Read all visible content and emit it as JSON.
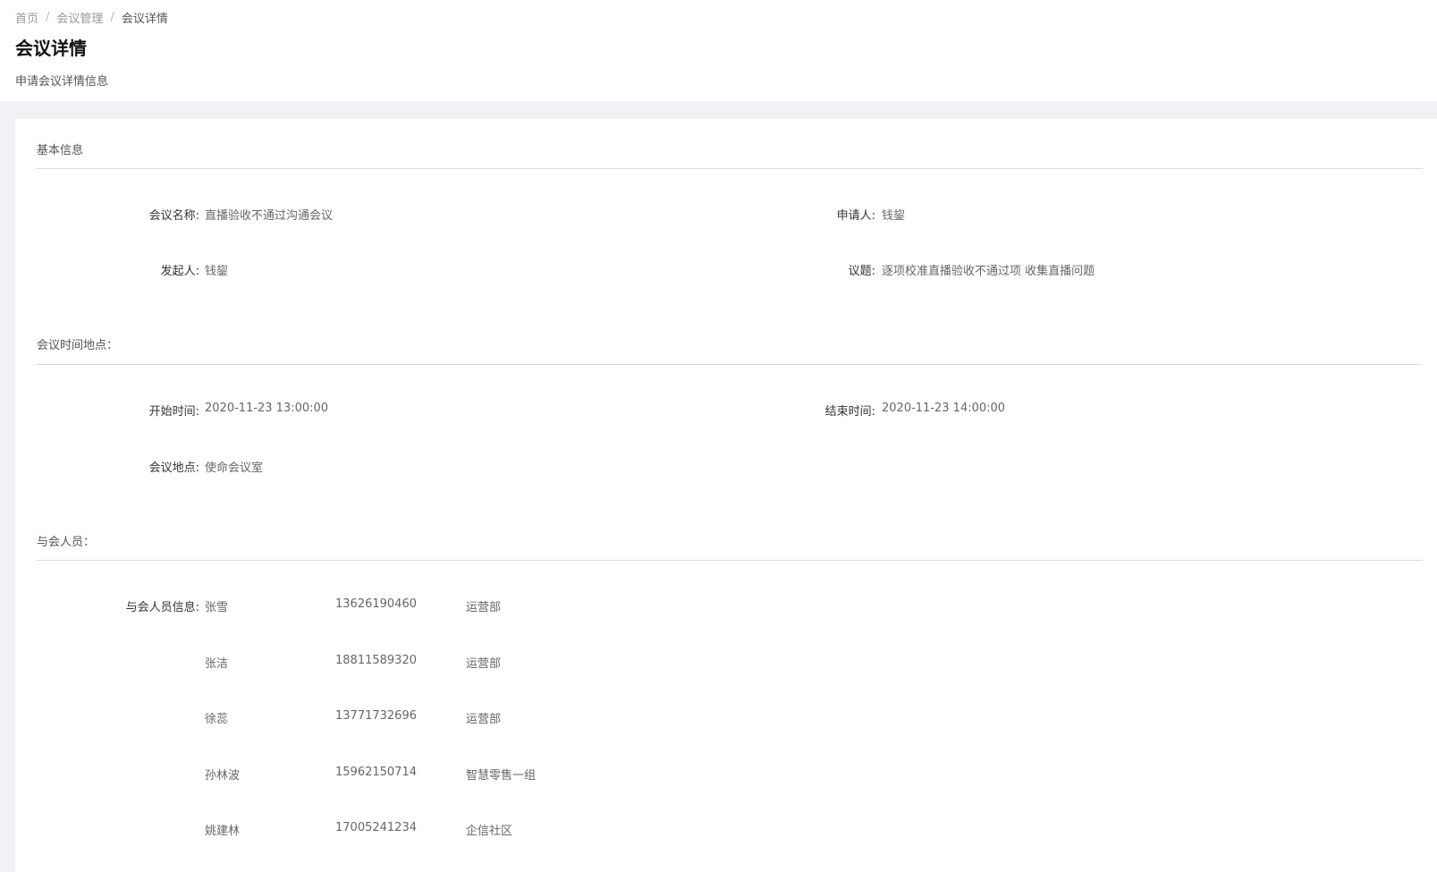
{
  "breadcrumb": [
    "首页",
    "会议管理",
    "会议详情"
  ],
  "breadcrumb_sep": "/",
  "page": {
    "title": "会议详情",
    "subtitle": "申请会议详情信息"
  },
  "basic": {
    "title": "基本信息",
    "meeting_name_label": "会议名称:",
    "meeting_name": "直播验收不通过沟通会议",
    "applicant_label": "申请人:",
    "applicant": "钱鋆",
    "initiator_label": "发起人:",
    "initiator": "钱鋆",
    "topic_label": "议题:",
    "topic": "逐项校准直播验收不通过项 收集直播问题"
  },
  "time_place": {
    "title": "会议时间地点：",
    "start_label": "开始时间:",
    "start": "2020-11-23 13:00:00",
    "end_label": "结束时间:",
    "end": "2020-11-23 14:00:00",
    "place_label": "会议地点:",
    "place": "使命会议室"
  },
  "attendees": {
    "title": "与会人员：",
    "label": "与会人员信息:",
    "rows": [
      {
        "name": "张雪",
        "phone": "13626190460",
        "dept": "运营部"
      },
      {
        "name": "张洁",
        "phone": "18811589320",
        "dept": "运营部"
      },
      {
        "name": "徐蕊",
        "phone": "13771732696",
        "dept": "运营部"
      },
      {
        "name": "孙林波",
        "phone": "15962150714",
        "dept": "智慧零售一组"
      },
      {
        "name": "姚建林",
        "phone": "17005241234",
        "dept": "企信社区"
      }
    ]
  }
}
